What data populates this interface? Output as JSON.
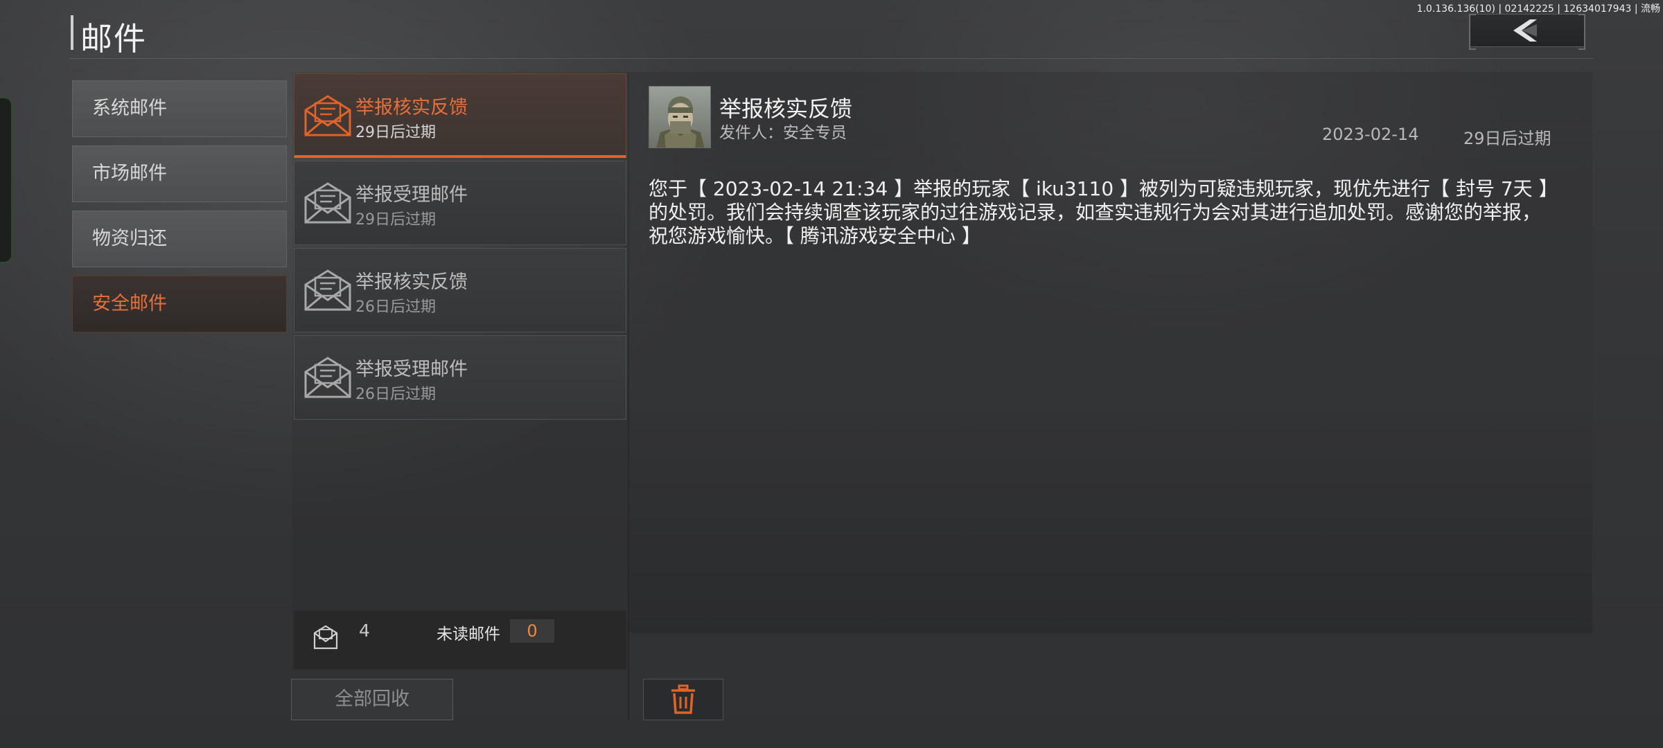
{
  "header": {
    "title": "邮件",
    "version": "1.0.136.136(10) | 02142225 | 12634017943 | 流畅"
  },
  "sidebar": {
    "items": [
      {
        "label": "系统邮件",
        "active": false
      },
      {
        "label": "市场邮件",
        "active": false
      },
      {
        "label": "物资归还",
        "active": false
      },
      {
        "label": "安全邮件",
        "active": true
      }
    ]
  },
  "mail_list": {
    "items": [
      {
        "title": "举报核实反馈",
        "expire": "29日后过期",
        "selected": true
      },
      {
        "title": "举报受理邮件",
        "expire": "29日后过期",
        "selected": false
      },
      {
        "title": "举报核实反馈",
        "expire": "26日后过期",
        "selected": false
      },
      {
        "title": "举报受理邮件",
        "expire": "26日后过期",
        "selected": false
      }
    ],
    "total_count": "4",
    "unread_label": "未读邮件",
    "unread_count": "0",
    "collect_all_label": "全部回收"
  },
  "detail": {
    "title": "举报核实反馈",
    "sender": "发件人：安全专员",
    "date": "2023-02-14",
    "expire": "29日后过期",
    "body": "您于【 2023-02-14 21:34 】举报的玩家【 iku3110 】被列为可疑违规玩家，现优先进行【 封号 7天 】的处罚。我们会持续调查该玩家的过往游戏记录，如查实违规行为会对其进行追加处罚。感谢您的举报，祝您游戏愉快。【 腾讯游戏安全中心 】"
  },
  "colors": {
    "accent": "#e86f3a",
    "unread_count": "#ef8a3c",
    "background": "#353638"
  },
  "icons": [
    "back-arrow-icon",
    "mail-envelope-icon",
    "mail-count-icon",
    "trash-icon",
    "sender-avatar"
  ]
}
